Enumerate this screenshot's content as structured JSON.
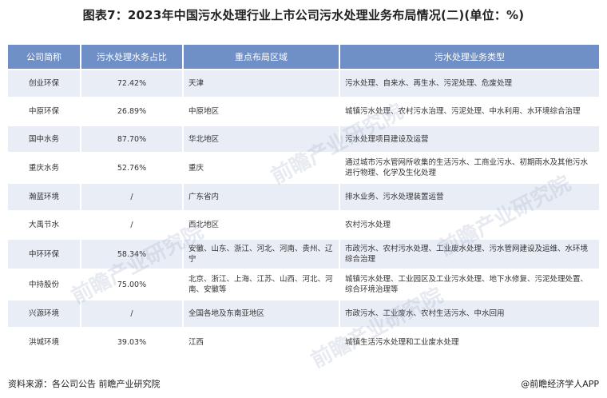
{
  "title": "图表7：2023年中国污水处理行业上市公司污水处理业务布局情况(二)(单位：%)",
  "table": {
    "headers": [
      "公司简称",
      "污水处理水务占比",
      "重点布局区域",
      "污水处理业务类型"
    ],
    "rows": [
      [
        "创业环保",
        "72.42%",
        "天津",
        "污水处理、自来水、再生水、污泥处理、危废处理"
      ],
      [
        "中原环保",
        "26.89%",
        "中原地区",
        "城镇污水处理、农村污水治理、污泥处理、中水利用、水环境综合治理"
      ],
      [
        "国中水务",
        "87.70%",
        "华北地区",
        "污水处理项目建设及运营"
      ],
      [
        "重庆水务",
        "52.76%",
        "重庆",
        "通过城市污水管网所收集的生活污水、工商业污水、初期雨水及其他污水进行物理、化学及生化处理"
      ],
      [
        "瀚蓝环境",
        "/",
        "广东省内",
        "排水业务、污水处理装置运营"
      ],
      [
        "大禹节水",
        "/",
        "西北地区",
        "农村污水处理"
      ],
      [
        "中环环保",
        "58.34%",
        "安徽、山东、浙江、河北、河南、贵州、辽宁",
        "市政污水、农村污水处理、工业废水处理、污水管网建设及运维、水环境综合治理"
      ],
      [
        "中持股份",
        "75.00%",
        "北京、浙江、上海、江苏、山西、河北、河南、安徽等",
        "城镇污水处理、工业园区及工业污水处理、地下水修复、污泥处理处置、综合环境治理等"
      ],
      [
        "兴源环境",
        "/",
        "全国各地及东南亚地区",
        "市政污水、工业废水、农村生活污水、中水回用"
      ],
      [
        "洪城环境",
        "39.03%",
        "江西",
        "城镇生活污水处理和工业废水处理"
      ]
    ]
  },
  "footer": {
    "source": "资料来源：各公司公告 前瞻产业研究院",
    "brand": "@前瞻经济学人APP"
  },
  "watermark": "前瞻产业研究院"
}
